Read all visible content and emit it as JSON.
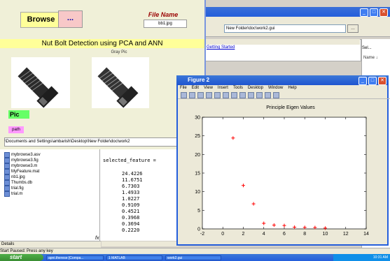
{
  "gui": {
    "browse_label": "Browse",
    "browse_button": "...",
    "filename_heading": "File Name",
    "filename_value": "bb1.jpg",
    "title": "Nut Bolt Detection using PCA and ANN",
    "gray_label": "Gray Pic",
    "pic_label": "Pic",
    "path_button": "path",
    "full_path": "\\Documents and Settings\\ambarish\\Desktop\\New Folder\\doc\\work2"
  },
  "matlab": {
    "path_field": "New Folder\\doc\\work2.gui",
    "help_link": "Getting Started",
    "right_tab": "Sel...",
    "right_name": "Name ↓",
    "files": [
      "mybrowse3.asv",
      "mybrowse3.fig",
      "mybrowse3.m",
      "MyFeature.mat",
      "nb1.jpg",
      "Thumbs.db",
      "trial.fig",
      "trial.m"
    ],
    "details_label": "Details",
    "command_var": "selected_feature =",
    "command_values": [
      "24.4226",
      "11.6751",
      "6.7303",
      "1.4933",
      "1.0227",
      "0.9109",
      "0.4521",
      "0.3968",
      "0.3694",
      "0.2220"
    ],
    "fx": "fx",
    "status": "Start  Paused: Press any key"
  },
  "taskbar": {
    "start": "start",
    "tasks": [
      "apni.therese [Compa...",
      "1 MATLAB",
      "work2.gui"
    ],
    "clock": "10:31 AM"
  },
  "figure": {
    "window_title": "Figure 2",
    "menus": [
      "File",
      "Edit",
      "View",
      "Insert",
      "Tools",
      "Desktop",
      "Window",
      "Help"
    ]
  },
  "chart_data": {
    "type": "scatter",
    "title": "Principle Eigen Values",
    "xlabel": "",
    "ylabel": "",
    "x": [
      1,
      2,
      3,
      4,
      5,
      6,
      7,
      8,
      9,
      10
    ],
    "y": [
      24.4226,
      11.6751,
      6.7303,
      1.4933,
      1.0227,
      0.9109,
      0.4521,
      0.3968,
      0.3694,
      0.222
    ],
    "xlim": [
      -2,
      14
    ],
    "ylim": [
      0,
      30
    ],
    "xticks": [
      "-2",
      "0",
      "2",
      "4",
      "6",
      "8",
      "10",
      "12",
      "14"
    ],
    "yticks": [
      "0",
      "5",
      "10",
      "15",
      "20",
      "25",
      "30"
    ],
    "marker": "+",
    "color": "#ff0000",
    "grid": false
  }
}
